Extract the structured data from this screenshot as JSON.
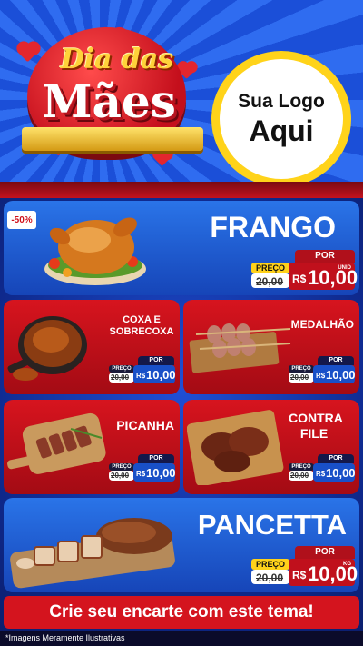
{
  "header": {
    "title_line1": "Dia das",
    "title_line2": "Mães",
    "logo_line1": "Sua Logo",
    "logo_line2": "Aqui"
  },
  "colors": {
    "blue": "#2a74e8",
    "red": "#d7141e",
    "yellow": "#ffd21a"
  },
  "products": {
    "frango": {
      "name": "FRANGO",
      "discount": "-50%",
      "por": "POR",
      "preco": "PREÇO",
      "old": "20,00",
      "currency": "R$",
      "price": "10,00",
      "unit": "UNID"
    },
    "coxa": {
      "name": "COXA E SOBRECOXA",
      "por": "POR",
      "preco": "PREÇO",
      "old": "20,00",
      "currency": "R$",
      "price": "10,00",
      "unit": "KG"
    },
    "medalhao": {
      "name": "MEDALHÃO",
      "por": "POR",
      "preco": "PREÇO",
      "old": "20,00",
      "currency": "R$",
      "price": "10,00",
      "unit": "KG"
    },
    "picanha": {
      "name": "PICANHA",
      "por": "POR",
      "preco": "PREÇO",
      "old": "20,00",
      "currency": "R$",
      "price": "10,00",
      "unit": "KG"
    },
    "contrafile": {
      "name": "CONTRA FILE",
      "por": "POR",
      "preco": "PREÇO",
      "old": "20,00",
      "currency": "R$",
      "price": "10,00",
      "unit": "KG"
    },
    "pancetta": {
      "name": "PANCETTA",
      "por": "POR",
      "preco": "PREÇO",
      "old": "20,00",
      "currency": "R$",
      "price": "10,00",
      "unit": "KG"
    }
  },
  "cta": "Crie seu encarte com este tema!",
  "disclaimer": "*Imagens Meramente Ilustrativas"
}
